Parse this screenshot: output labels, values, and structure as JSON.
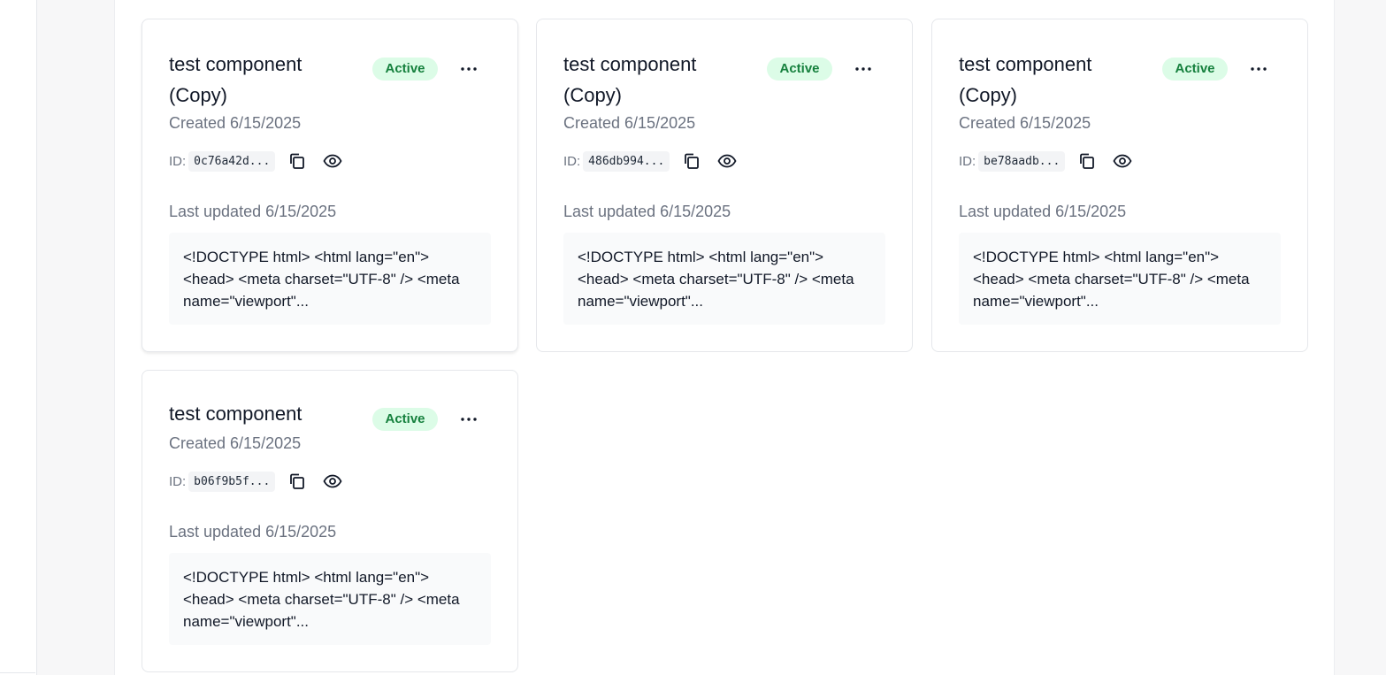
{
  "cards": [
    {
      "title": "test component (Copy)",
      "status": "Active",
      "created": "Created 6/15/2025",
      "id_label": "ID:",
      "id_value": "0c76a42d...",
      "updated": "Last updated 6/15/2025",
      "preview": "<!DOCTYPE html> <html lang=\"en\"> <head> <meta charset=\"UTF-8\" /> <meta name=\"viewport\"..."
    },
    {
      "title": "test component (Copy)",
      "status": "Active",
      "created": "Created 6/15/2025",
      "id_label": "ID:",
      "id_value": "486db994...",
      "updated": "Last updated 6/15/2025",
      "preview": "<!DOCTYPE html> <html lang=\"en\"> <head> <meta charset=\"UTF-8\" /> <meta name=\"viewport\"..."
    },
    {
      "title": "test component (Copy)",
      "status": "Active",
      "created": "Created 6/15/2025",
      "id_label": "ID:",
      "id_value": "be78aadb...",
      "updated": "Last updated 6/15/2025",
      "preview": "<!DOCTYPE html> <html lang=\"en\"> <head> <meta charset=\"UTF-8\" /> <meta name=\"viewport\"..."
    },
    {
      "title": "test component",
      "status": "Active",
      "created": "Created 6/15/2025",
      "id_label": "ID:",
      "id_value": "b06f9b5f...",
      "updated": "Last updated 6/15/2025",
      "preview": "<!DOCTYPE html> <html lang=\"en\"> <head> <meta charset=\"UTF-8\" /> <meta name=\"viewport\"..."
    }
  ],
  "icons": {
    "more": "more-horizontal-icon",
    "copy": "copy-icon",
    "view": "eye-icon"
  },
  "colors": {
    "badge_bg": "#dcfce7",
    "badge_text": "#15803d",
    "muted_text": "#6b7280",
    "card_border": "#e5e7eb",
    "preview_bg": "#f9fafb"
  }
}
